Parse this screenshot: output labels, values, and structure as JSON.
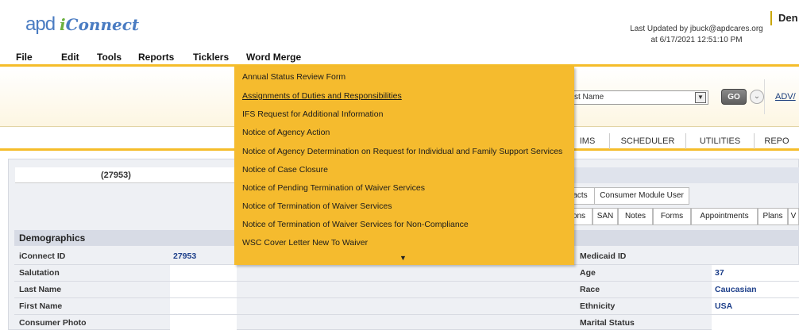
{
  "header": {
    "logo_mark": "apd",
    "logo_text": "Connect",
    "logo_i": "i",
    "last_updated_line1": "Last Updated by jbuck@apdcares.org",
    "last_updated_line2": "at 6/17/2021 12:51:10 PM",
    "user_name": "Den"
  },
  "menu": {
    "items": [
      {
        "label": "File"
      },
      {
        "label": "Edit"
      },
      {
        "label": "Tools"
      },
      {
        "label": "Reports"
      },
      {
        "label": "Ticklers"
      },
      {
        "label": "Word Merge"
      }
    ]
  },
  "search": {
    "field_value": "st Name",
    "go_label": "GO",
    "circle_icon": "chevron-down-circle",
    "advanced_label": "ADV/"
  },
  "main_tabs": [
    {
      "label": "IMS"
    },
    {
      "label": "SCHEDULER"
    },
    {
      "label": "UTILITIES"
    },
    {
      "label": "REPO"
    }
  ],
  "consumer": {
    "id_display": "(27953)"
  },
  "subtabs_row1": [
    {
      "label": "acts"
    },
    {
      "label": "Consumer Module User"
    }
  ],
  "subtabs_row2": [
    {
      "label": "ons"
    },
    {
      "label": "SAN"
    },
    {
      "label": "Notes"
    },
    {
      "label": "Forms"
    },
    {
      "label": "Appointments"
    },
    {
      "label": "Plans"
    },
    {
      "label": "V"
    }
  ],
  "demographics": {
    "title": "Demographics",
    "rows": [
      {
        "label": "iConnect ID",
        "value": "27953",
        "label2": "Medicaid ID",
        "value2": ""
      },
      {
        "label": "Salutation",
        "value": "",
        "label2": "Age",
        "value2": "37"
      },
      {
        "label": "Last Name",
        "value": "",
        "label2": "Race",
        "value2": "Caucasian"
      },
      {
        "label": "First Name",
        "value": "",
        "label2": "Ethnicity",
        "value2": "USA"
      },
      {
        "label": "Consumer Photo",
        "value": "",
        "label2": "Marital Status",
        "value2": ""
      }
    ]
  },
  "word_merge_menu": {
    "items": [
      {
        "label": "Annual Status Review Form"
      },
      {
        "label": "Assignments of Duties and Responsibilities"
      },
      {
        "label": "IFS Request for Additional Information"
      },
      {
        "label": "Notice of Agency Action"
      },
      {
        "label": "Notice of Agency Determination on Request for Individual and Family Support Services"
      },
      {
        "label": "Notice of Case Closure"
      },
      {
        "label": "Notice of Pending Termination of Waiver Services"
      },
      {
        "label": "Notice of Termination of Waiver Services"
      },
      {
        "label": "Notice of Termination of Waiver Services for Non-Compliance"
      },
      {
        "label": "WSC Cover Letter New To Waiver"
      }
    ],
    "more_arrow": "▼"
  },
  "colors": {
    "accent": "#f5bd2a",
    "dropdown_bg": "#f5bb2e",
    "link_blue": "#1d3f8a",
    "logo_blue": "#4a7cc2"
  }
}
